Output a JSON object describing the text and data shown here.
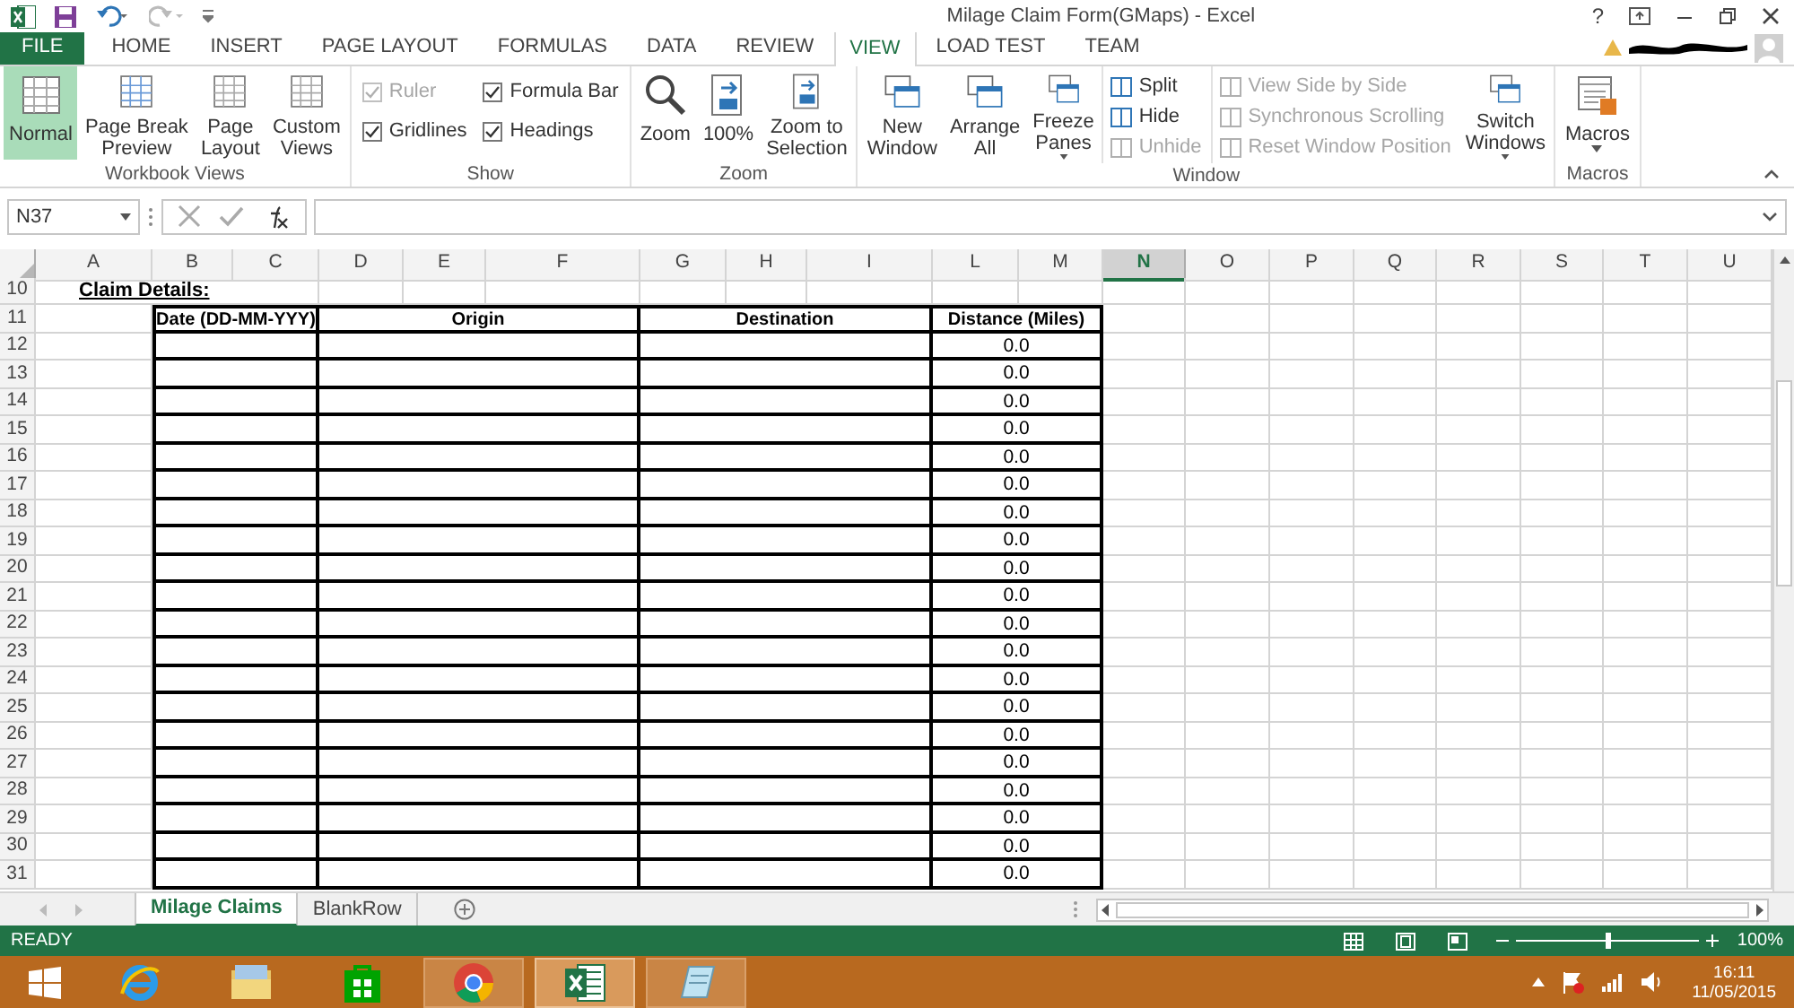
{
  "window": {
    "title": "Milage Claim Form(GMaps) - Excel",
    "help": "?"
  },
  "ribbon_tabs": [
    {
      "label": "FILE",
      "kind": "file",
      "selected": false
    },
    {
      "label": "HOME",
      "kind": "tab",
      "selected": false
    },
    {
      "label": "INSERT",
      "kind": "tab",
      "selected": false
    },
    {
      "label": "PAGE LAYOUT",
      "kind": "tab",
      "selected": false
    },
    {
      "label": "FORMULAS",
      "kind": "tab",
      "selected": false
    },
    {
      "label": "DATA",
      "kind": "tab",
      "selected": false
    },
    {
      "label": "REVIEW",
      "kind": "tab",
      "selected": false
    },
    {
      "label": "VIEW",
      "kind": "tab",
      "selected": true
    },
    {
      "label": "LOAD TEST",
      "kind": "tab",
      "selected": false
    },
    {
      "label": "TEAM",
      "kind": "tab",
      "selected": false
    }
  ],
  "ribbon_groups": [
    {
      "label": "Workbook Views",
      "items": [
        {
          "kind": "large",
          "label": "Normal",
          "selected": true
        },
        {
          "kind": "large",
          "label": "Page Break\nPreview",
          "selected": false
        },
        {
          "kind": "large",
          "label": "Page\nLayout",
          "selected": false
        },
        {
          "kind": "large",
          "label": "Custom\nViews",
          "selected": false
        }
      ]
    },
    {
      "label": "Show",
      "items": [
        {
          "kind": "checks",
          "checks": [
            {
              "label": "Ruler",
              "checked": true,
              "disabled": true
            },
            {
              "label": "Gridlines",
              "checked": true,
              "disabled": false
            }
          ]
        },
        {
          "kind": "checks",
          "checks": [
            {
              "label": "Formula Bar",
              "checked": true,
              "disabled": false
            },
            {
              "label": "Headings",
              "checked": true,
              "disabled": false
            }
          ]
        }
      ]
    },
    {
      "label": "Zoom",
      "items": [
        {
          "kind": "large",
          "label": "Zoom",
          "selected": false
        },
        {
          "kind": "large",
          "label": "100%",
          "selected": false
        },
        {
          "kind": "large",
          "label": "Zoom to\nSelection",
          "selected": false
        }
      ]
    },
    {
      "label": "Window",
      "items": [
        {
          "kind": "large",
          "label": "New\nWindow",
          "selected": false
        },
        {
          "kind": "large",
          "label": "Arrange\nAll",
          "selected": false
        },
        {
          "kind": "dropdown",
          "label": "Freeze\nPanes",
          "selected": false
        },
        {
          "kind": "small",
          "entries": [
            {
              "label": "Split",
              "disabled": false
            },
            {
              "label": "Hide",
              "disabled": false
            },
            {
              "label": "Unhide",
              "disabled": true
            }
          ]
        },
        {
          "kind": "small",
          "entries": [
            {
              "label": "View Side by Side",
              "disabled": true
            },
            {
              "label": "Synchronous Scrolling",
              "disabled": true
            },
            {
              "label": "Reset Window Position",
              "disabled": true
            }
          ]
        },
        {
          "kind": "dropdown",
          "label": "Switch\nWindows",
          "selected": false
        }
      ]
    },
    {
      "label": "Macros",
      "items": [
        {
          "kind": "dropdown",
          "label": "Macros",
          "selected": false
        }
      ]
    }
  ],
  "formula_bar": {
    "name_box": "N37"
  },
  "columns": [
    {
      "label": "A",
      "selected": false
    },
    {
      "label": "B",
      "selected": false
    },
    {
      "label": "C",
      "selected": false
    },
    {
      "label": "D",
      "selected": false
    },
    {
      "label": "E",
      "selected": false
    },
    {
      "label": "F",
      "selected": false
    },
    {
      "label": "G",
      "selected": false
    },
    {
      "label": "H",
      "selected": false
    },
    {
      "label": "I",
      "selected": false
    },
    {
      "label": "L",
      "selected": false
    },
    {
      "label": "M",
      "selected": false
    },
    {
      "label": "N",
      "selected": true
    },
    {
      "label": "O",
      "selected": false
    },
    {
      "label": "P",
      "selected": false
    },
    {
      "label": "Q",
      "selected": false
    },
    {
      "label": "R",
      "selected": false
    },
    {
      "label": "S",
      "selected": false
    },
    {
      "label": "T",
      "selected": false
    },
    {
      "label": "U",
      "selected": false
    }
  ],
  "rows": [
    {
      "number": "10",
      "kind": "title",
      "text": "Claim Details:"
    },
    {
      "number": "11",
      "kind": "header",
      "cells": [
        "Date (DD-MM-YYY)",
        "Origin",
        "Destination",
        "Distance (Miles)"
      ]
    },
    {
      "number": "12",
      "kind": "entry",
      "distance": "0.0"
    },
    {
      "number": "13",
      "kind": "entry",
      "distance": "0.0"
    },
    {
      "number": "14",
      "kind": "entry",
      "distance": "0.0"
    },
    {
      "number": "15",
      "kind": "entry",
      "distance": "0.0"
    },
    {
      "number": "16",
      "kind": "entry",
      "distance": "0.0"
    },
    {
      "number": "17",
      "kind": "entry",
      "distance": "0.0"
    },
    {
      "number": "18",
      "kind": "entry",
      "distance": "0.0"
    },
    {
      "number": "19",
      "kind": "entry",
      "distance": "0.0"
    },
    {
      "number": "20",
      "kind": "entry",
      "distance": "0.0"
    },
    {
      "number": "21",
      "kind": "entry",
      "distance": "0.0"
    },
    {
      "number": "22",
      "kind": "entry",
      "distance": "0.0"
    },
    {
      "number": "23",
      "kind": "entry",
      "distance": "0.0"
    },
    {
      "number": "24",
      "kind": "entry",
      "distance": "0.0"
    },
    {
      "number": "25",
      "kind": "entry",
      "distance": "0.0"
    },
    {
      "number": "26",
      "kind": "entry",
      "distance": "0.0"
    },
    {
      "number": "27",
      "kind": "entry",
      "distance": "0.0"
    },
    {
      "number": "28",
      "kind": "entry",
      "distance": "0.0"
    },
    {
      "number": "29",
      "kind": "entry",
      "distance": "0.0"
    },
    {
      "number": "30",
      "kind": "entry",
      "distance": "0.0"
    },
    {
      "number": "31",
      "kind": "entry",
      "distance": "0.0"
    }
  ],
  "sheet_tabs": [
    {
      "label": "Milage Claims",
      "selected": true
    },
    {
      "label": "BlankRow",
      "selected": false
    }
  ],
  "status_bar": {
    "status": "READY",
    "zoom": "100%",
    "level": 0.5
  },
  "taskbar": {
    "apps": [
      {
        "selected": false
      },
      {
        "selected": false
      },
      {
        "selected": false
      },
      {
        "selected": false
      },
      {
        "selected": false
      },
      {
        "selected": true
      },
      {
        "selected": false
      }
    ],
    "time": "16:11",
    "date": "11/05/2015"
  }
}
